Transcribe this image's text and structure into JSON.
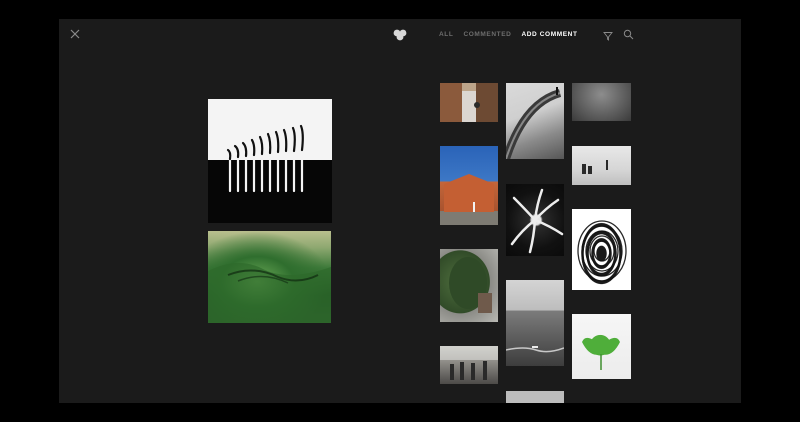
{
  "header": {
    "close_icon": "close-icon",
    "logo_icon": "heart-logo-icon",
    "tabs": [
      {
        "label": "ALL",
        "active": false
      },
      {
        "label": "COMMENTED",
        "active": false
      },
      {
        "label": "ADD COMMENT",
        "active": true
      }
    ],
    "filter_icon": "filter-icon",
    "search_icon": "search-icon"
  },
  "featured": [
    {
      "subject": "matches-photo"
    },
    {
      "subject": "green-wave-photo"
    }
  ],
  "grid": [
    {
      "subject": "wooden-door-photo"
    },
    {
      "subject": "orange-house-photo"
    },
    {
      "subject": "hedge-photo"
    },
    {
      "subject": "street-crowd-photo"
    },
    {
      "subject": "bridge-arch-photo"
    },
    {
      "subject": "spiral-photo"
    },
    {
      "subject": "sea-horizon-photo"
    },
    {
      "subject": "partial-photo"
    },
    {
      "subject": "dark-gradient-photo"
    },
    {
      "subject": "beach-people-photo"
    },
    {
      "subject": "fingerprint-photo"
    },
    {
      "subject": "ginkgo-leaf-photo"
    }
  ],
  "colors": {
    "background": "#000000",
    "panel": "#1b1b1b",
    "tab_inactive": "#6e6e6e",
    "tab_active": "#ffffff"
  }
}
